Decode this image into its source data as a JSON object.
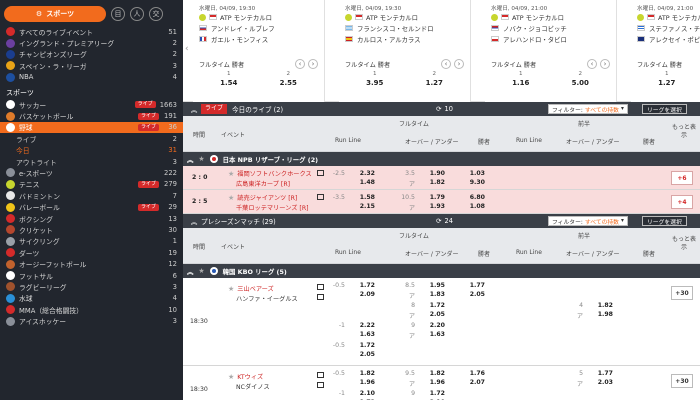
{
  "sidebar": {
    "sports_button": "スポーツ",
    "top_icons": [
      "目",
      "人",
      "交"
    ],
    "live_rows": [
      {
        "label": "すべてのライブイベント",
        "count": "51",
        "color": "#d42a2a"
      },
      {
        "label": "イングランド・プレミアリーグ",
        "count": "2",
        "color": "#6b3fa0"
      },
      {
        "label": "チャンピオンズリーグ",
        "count": "2",
        "color": "#1a3d8f"
      },
      {
        "label": "スペイン・ラ・リーガ",
        "count": "3",
        "color": "#e8a317"
      },
      {
        "label": "NBA",
        "count": "4",
        "color": "#1d4fa0"
      }
    ],
    "sports_header": "スポーツ",
    "sports": [
      {
        "label": "サッカー",
        "count": "1663",
        "live": "ライブ",
        "color": "#ffffff"
      },
      {
        "label": "バスケットボール",
        "count": "191",
        "live": "ライブ",
        "color": "#e07b2a"
      },
      {
        "label": "野球",
        "count": "36",
        "live": "ライブ",
        "color": "#ffffff",
        "selected": true
      },
      {
        "label": "ライブ",
        "count": "2",
        "sub": true
      },
      {
        "label": "今日",
        "count": "31",
        "sub": true,
        "active": true
      },
      {
        "label": "アウトライト",
        "count": "3",
        "sub": true
      },
      {
        "label": "e-スポーツ",
        "count": "222",
        "color": "#8a8f99"
      },
      {
        "label": "テニス",
        "count": "279",
        "live": "ライブ",
        "color": "#c7d62e"
      },
      {
        "label": "バドミントン",
        "count": "7",
        "color": "#e8e8e8"
      },
      {
        "label": "バレーボール",
        "count": "29",
        "live": "ライブ",
        "color": "#f0c419"
      },
      {
        "label": "ボクシング",
        "count": "13",
        "color": "#d42a2a"
      },
      {
        "label": "クリケット",
        "count": "30",
        "color": "#b5462d"
      },
      {
        "label": "サイクリング",
        "count": "1",
        "color": "#9aa0a8"
      },
      {
        "label": "ダーツ",
        "count": "19",
        "color": "#d42a2a"
      },
      {
        "label": "オージーフットボール",
        "count": "12",
        "color": "#c2622d"
      },
      {
        "label": "フットサル",
        "count": "6",
        "color": "#ffffff"
      },
      {
        "label": "ラグビーリーグ",
        "count": "3",
        "color": "#a0522d"
      },
      {
        "label": "水球",
        "count": "4",
        "color": "#2a8fd6"
      },
      {
        "label": "MMA（総合格闘技）",
        "count": "10",
        "color": "#d42a2a"
      },
      {
        "label": "アイスホッケー",
        "count": "3",
        "color": "#8a8f99"
      }
    ]
  },
  "carousel": [
    {
      "time": "水曜日, 04/09, 19:30",
      "league": "ATP モンテカルロ",
      "p1": "アンドレイ・ルブレフ",
      "p2": "ガエル・モンフィス",
      "f1": "ru",
      "f2": "fr",
      "market": "フルタイム 勝者",
      "l1": "1",
      "l2": "2",
      "o1": "1.54",
      "o2": "2.55"
    },
    {
      "time": "水曜日, 04/09, 19:30",
      "league": "ATP モンテカルロ",
      "p1": "フランシスコ・セルンドロ",
      "p2": "カルロス・アルカラス",
      "f1": "ar",
      "f2": "es",
      "market": "フルタイム 勝者",
      "l1": "1",
      "l2": "2",
      "o1": "3.95",
      "o2": "1.27"
    },
    {
      "time": "水曜日, 04/09, 21:00",
      "league": "ATP モンテカルロ",
      "p1": "ノバク・ジョコビッチ",
      "p2": "アレハンドロ・タビロ",
      "f1": "rs",
      "f2": "cl",
      "market": "フルタイム 勝者",
      "l1": "1",
      "l2": "2",
      "o1": "1.16",
      "o2": "5.00"
    },
    {
      "time": "水曜日, 04/09, 21:00",
      "league": "ATP モンテカルロ",
      "p1": "ステファノス・チチパス",
      "p2": "アレクセイ・ポピリン",
      "f1": "gr",
      "f2": "au",
      "market": "フルタイム 勝者",
      "l1": "1",
      "l2": "",
      "o1": "1.27",
      "o2": ""
    }
  ],
  "live_section": {
    "tag": "ライブ",
    "title": "今日のライブ (2)",
    "count": "10",
    "filter_label": "フィルター:",
    "filter_value": "すべての持数",
    "league_select": "リーグを選択"
  },
  "headers": {
    "time": "時間",
    "event": "イベント",
    "fulltime": "フルタイム",
    "half": "前半",
    "runline": "Run Line",
    "ou": "オーバー / アンダー",
    "winner": "勝者",
    "more": "もっと表示"
  },
  "live_league": "日本 NPB リザーブ・リーグ (2)",
  "live_matches": [
    {
      "score": "2 : 0",
      "t1": "福岡ソフトバンクホークス",
      "t2": "広島東洋カープ [R]",
      "rl_h": "-2.5",
      "rl1": "2.32",
      "rl2": "1.48",
      "ou_h": "3.5",
      "ou_u": "ア",
      "ou1": "1.90",
      "ou2": "1.82",
      "w1": "1.03",
      "w2": "9.30",
      "more": "+6"
    },
    {
      "score": "2 : 5",
      "t1": "読売ジャイアンツ [R]",
      "t2": "千葉ロッテマリーンズ [R]",
      "rl_h": "-3.5",
      "rl1": "1.58",
      "rl2": "2.15",
      "ou_h": "10.5",
      "ou_u": "ア",
      "ou1": "1.79",
      "ou2": "1.93",
      "w1": "6.80",
      "w2": "1.08",
      "more": "+4"
    }
  ],
  "pre_section": {
    "title": "プレシーズンマッチ (29)",
    "count": "24",
    "filter_label": "フィルター:",
    "filter_value": "すべての持数",
    "league_select": "リーグを選択"
  },
  "pre_league": "韓国 KBO リーグ (5)",
  "pre_matches": [
    {
      "time": "18:30",
      "t1": "三山ベアーズ",
      "t2": "ハンファ・イーグルス",
      "rows": [
        {
          "h": "-0.5",
          "a": "1.72",
          "b": "2.09",
          "ouh": "8.5",
          "ouu": "ア",
          "o1": "1.95",
          "o2": "1.83",
          "w1": "1.77",
          "w2": "2.05",
          "hh": "",
          "hu": "",
          "h1": "",
          "h2": ""
        },
        {
          "h": "",
          "a": "",
          "b": "",
          "ouh": "8",
          "ouu": "ア",
          "o1": "1.72",
          "o2": "2.05",
          "w1": "",
          "w2": "",
          "hh": "4",
          "hu": "ア",
          "h1": "1.82",
          "h2": "1.98"
        },
        {
          "h": "-1",
          "a": "2.22",
          "b": "1.63",
          "ouh": "9",
          "ouu": "ア",
          "o1": "2.20",
          "o2": "1.63",
          "w1": "",
          "w2": "",
          "hh": "",
          "hu": "",
          "h1": "",
          "h2": ""
        },
        {
          "h": "-0.5",
          "a": "1.72",
          "b": "2.05",
          "ouh": "",
          "ouu": "",
          "o1": "",
          "o2": "",
          "w1": "",
          "w2": "",
          "hh": "",
          "hu": "",
          "h1": "",
          "h2": ""
        }
      ],
      "more": "+30"
    },
    {
      "time": "18:30",
      "t1": "KTウィズ",
      "t2": "NCダイノス",
      "rows": [
        {
          "h": "-0.5",
          "a": "1.82",
          "b": "1.96",
          "ouh": "9.5",
          "ouu": "ア",
          "o1": "1.82",
          "o2": "1.96",
          "w1": "1.76",
          "w2": "2.07",
          "hh": "5",
          "hu": "ア",
          "h1": "1.77",
          "h2": "2.03"
        },
        {
          "h": "-1",
          "a": "2.10",
          "b": "1.72",
          "ouh": "9",
          "ouu": "ア",
          "o1": "1.72",
          "o2": "2.10",
          "w1": "",
          "w2": "",
          "hh": "",
          "hu": "",
          "h1": "",
          "h2": ""
        }
      ],
      "more": "+30"
    }
  ]
}
